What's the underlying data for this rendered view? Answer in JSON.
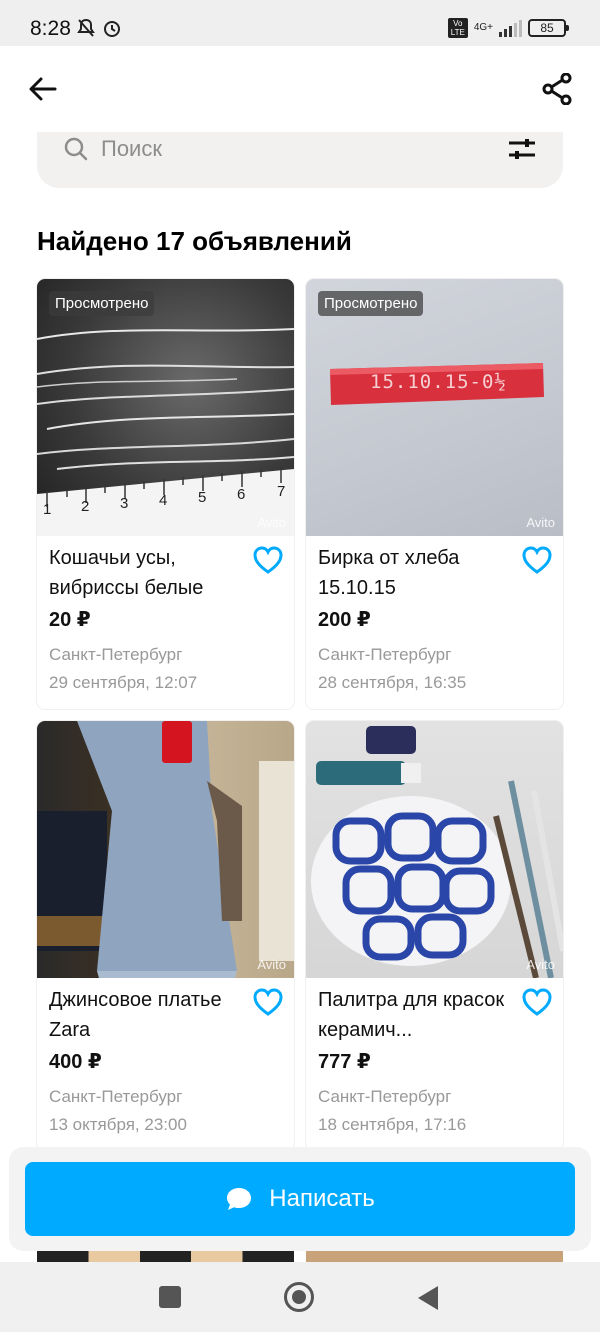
{
  "status_bar": {
    "time": "8:28",
    "network": "4G+",
    "volte": "Vo LTE",
    "battery": "85"
  },
  "search": {
    "placeholder": "Поиск"
  },
  "results": {
    "title": "Найдено 17 объявлений"
  },
  "listings": [
    {
      "badge": "Просмотрено",
      "title": "Кошачьи усы, вибриссы белые",
      "price": "20 ₽",
      "city": "Санкт-Петербург",
      "date": "29 сентября, 12:07",
      "watermark": "Avito",
      "ruler_marks": [
        "1",
        "2",
        "3",
        "4",
        "5",
        "6",
        "7"
      ]
    },
    {
      "badge": "Просмотрено",
      "title": "Бирка от хлеба 15.10.15",
      "price": "200 ₽",
      "city": "Санкт-Петербург",
      "date": "28 сентября, 16:35",
      "watermark": "Avito",
      "tag_text": "15.10.15-0½"
    },
    {
      "title": "Джинсовое платье Zara",
      "price": "400 ₽",
      "city": "Санкт-Петербург",
      "date": "13 октября, 23:00",
      "watermark": "Avito"
    },
    {
      "title": "Палитра для красок керамич...",
      "price": "777 ₽",
      "city": "Санкт-Петербург",
      "date": "18 сентября, 17:16",
      "watermark": "Avito"
    }
  ],
  "write_button": {
    "label": "Написать"
  },
  "colors": {
    "accent": "#00aaff",
    "favorite": "#00aaff",
    "muted_text": "#999999"
  }
}
